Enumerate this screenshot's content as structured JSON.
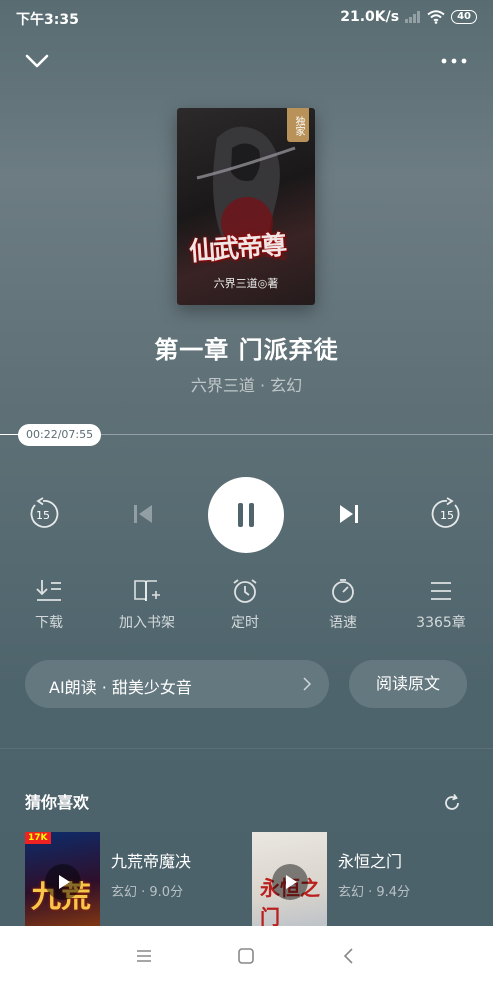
{
  "status_bar": {
    "time": "下午3:35",
    "network_speed": "21.0K/s",
    "battery": "40"
  },
  "book": {
    "cover_badge": "独家",
    "cover_title": "仙武帝尊",
    "cover_author": "六界三道◎著",
    "chapter_title": "第一章  门派弃徒",
    "meta": "六界三道 · 玄幻"
  },
  "player": {
    "elapsed": "00:22",
    "total": "07:55",
    "time_display": "00:22/07:55",
    "progress_fraction": 0.046,
    "rewind_seconds": "15",
    "forward_seconds": "15",
    "state": "playing"
  },
  "actions": [
    {
      "label": "下载",
      "icon": "download-list-icon"
    },
    {
      "label": "加入书架",
      "icon": "add-to-bookshelf-icon"
    },
    {
      "label": "定时",
      "icon": "alarm-clock-icon"
    },
    {
      "label": "语速",
      "icon": "speed-dial-icon"
    },
    {
      "label": "3365章",
      "icon": "chapter-list-icon"
    }
  ],
  "voice": {
    "label": "AI朗读 · 甜美少女音"
  },
  "read_original": "阅读原文",
  "recommendations": {
    "title": "猜你喜欢",
    "items": [
      {
        "name": "九荒帝魔决",
        "meta": "玄幻 · 9.0分",
        "cover_text": "九荒",
        "cover_tag": "17K"
      },
      {
        "name": "永恒之门",
        "meta": "玄幻 · 9.4分",
        "cover_text": "永恒之门"
      }
    ]
  },
  "colors": {
    "background": "#5b6e74",
    "pill_text": "#5b6e74",
    "accent_white": "#ffffff"
  }
}
